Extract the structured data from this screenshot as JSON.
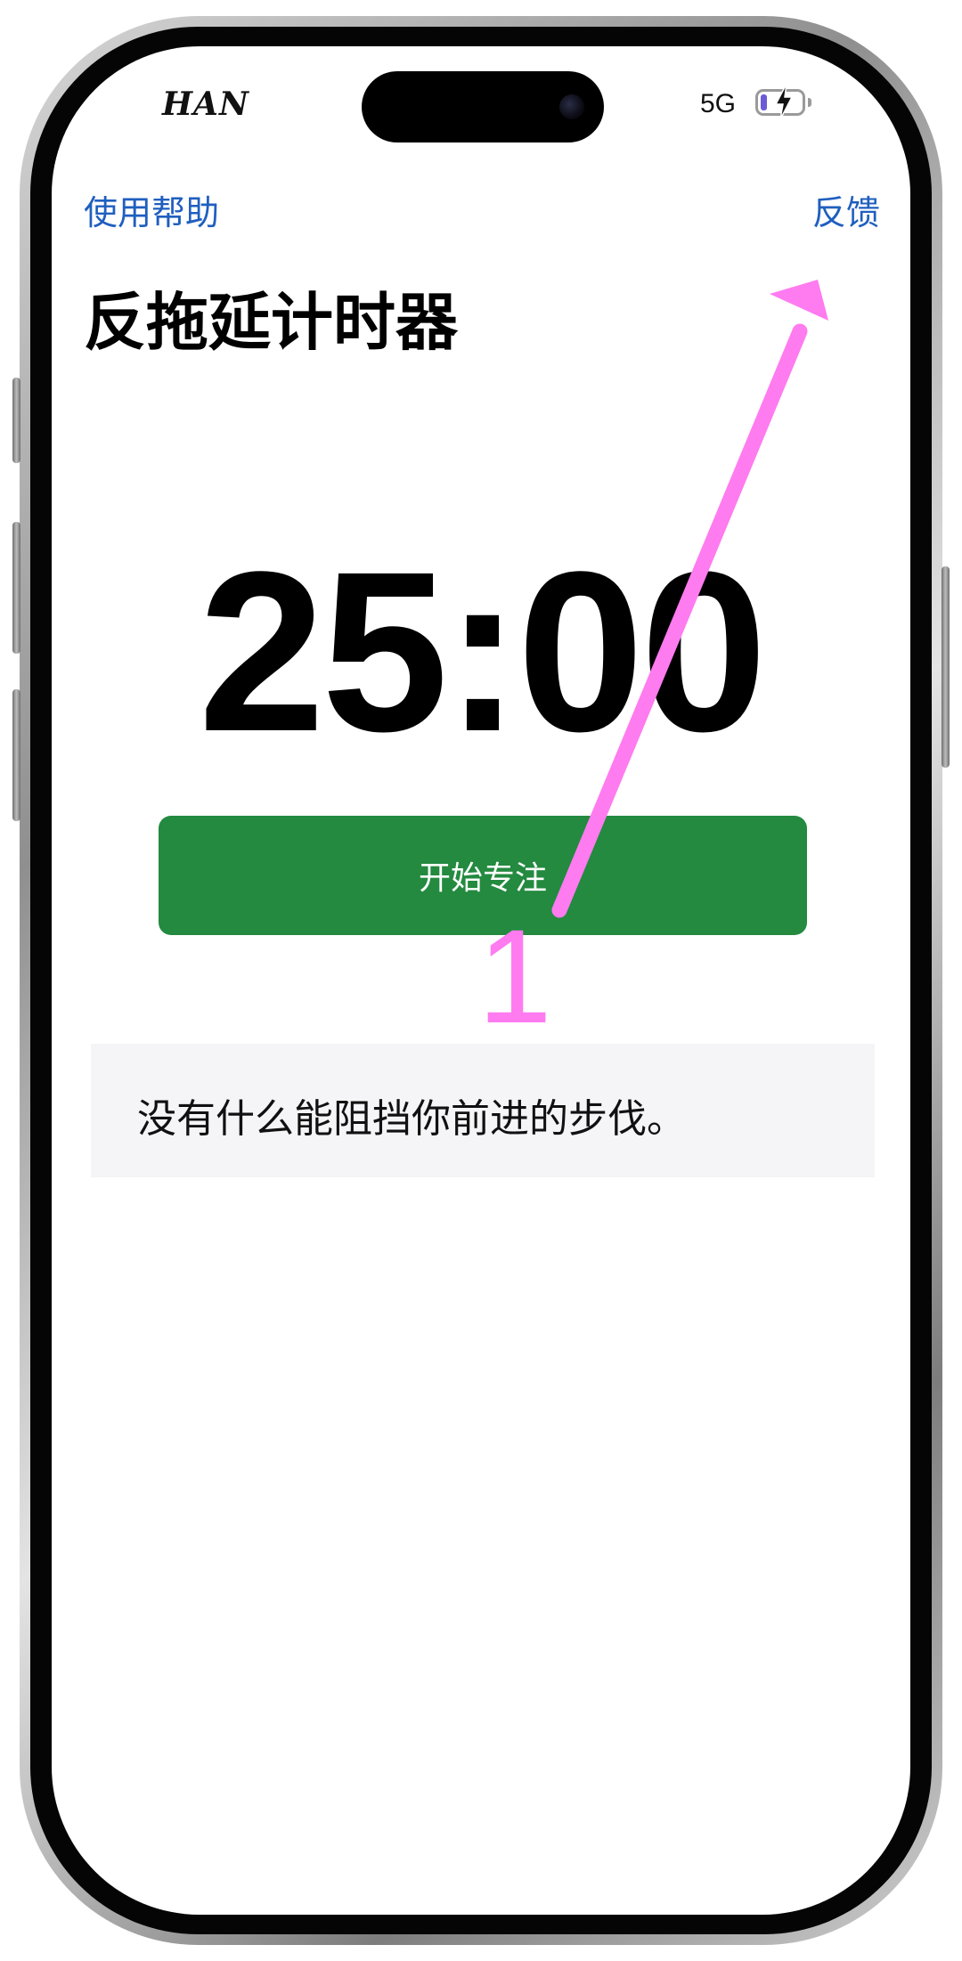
{
  "status_bar": {
    "carrier": "HAN",
    "network": "5G",
    "battery_level": 0.15,
    "charging": true
  },
  "nav": {
    "help_label": "使用帮助",
    "feedback_label": "反馈"
  },
  "app": {
    "title": "反拖延计时器"
  },
  "timer": {
    "display": "25:00"
  },
  "actions": {
    "start_label": "开始专注"
  },
  "quote": {
    "text": "没有什么能阻挡你前进的步伐。"
  },
  "annotation": {
    "step_number": "1",
    "color": "#ff7bf0",
    "target": "feedback-link"
  },
  "colors": {
    "link": "#1f5fbf",
    "primary_button": "#238a3f",
    "quote_background": "#f5f5f7"
  }
}
